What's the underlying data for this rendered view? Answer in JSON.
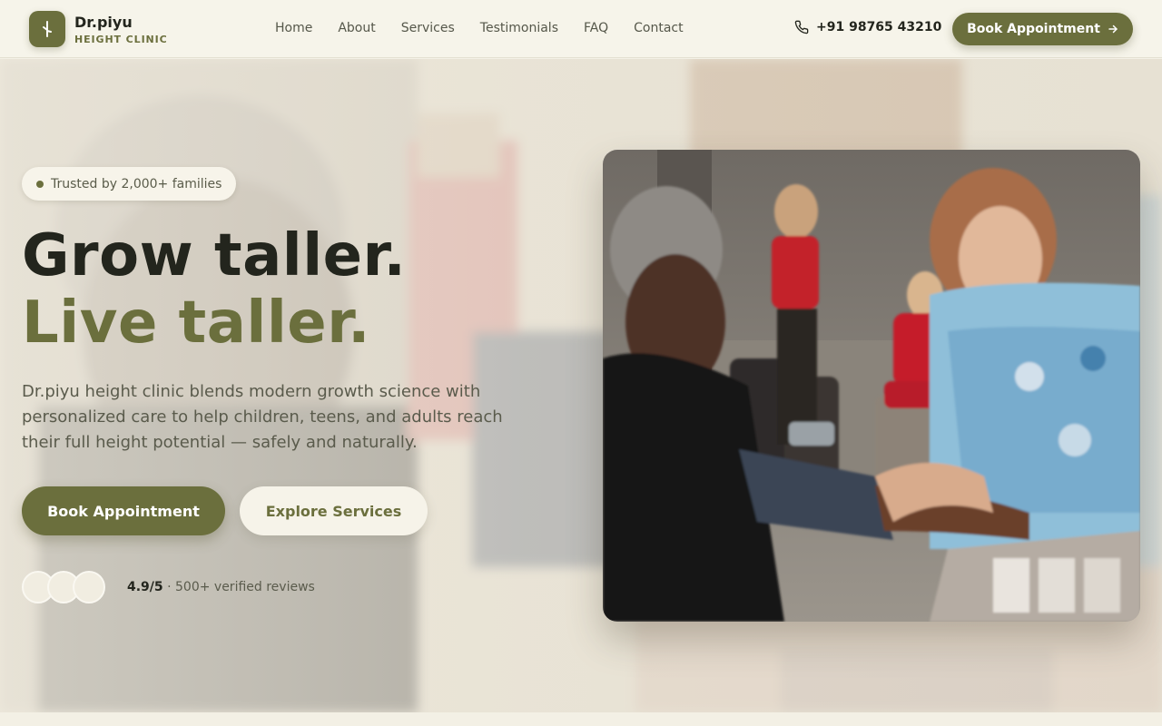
{
  "brand": {
    "name": "Dr.piyu",
    "subtitle": "HEIGHT CLINIC",
    "logo_icon": "person-growth-icon"
  },
  "nav": {
    "items": [
      {
        "label": "Home"
      },
      {
        "label": "About"
      },
      {
        "label": "Services"
      },
      {
        "label": "Testimonials"
      },
      {
        "label": "FAQ"
      },
      {
        "label": "Contact"
      }
    ]
  },
  "header": {
    "phone_icon": "phone-icon",
    "phone": "+91 98765 43210",
    "cta_label": "Book Appointment",
    "cta_icon": "arrow-right-icon"
  },
  "hero": {
    "badge": "Trusted by 2,000+ families",
    "headline_line1": "Grow taller.",
    "headline_line2": "Live taller.",
    "description": "Dr.piyu height clinic blends modern growth science with personalized care to help children, teens, and adults reach their full height potential — safely and naturally.",
    "primary_cta": "Book Appointment",
    "secondary_cta": "Explore Services",
    "rating_score": "4.9/5",
    "rating_text": "· 500+ verified reviews"
  },
  "colors": {
    "accent": "#6b6f3d",
    "background": "#f4f1e6",
    "text_dark": "#23251d"
  }
}
